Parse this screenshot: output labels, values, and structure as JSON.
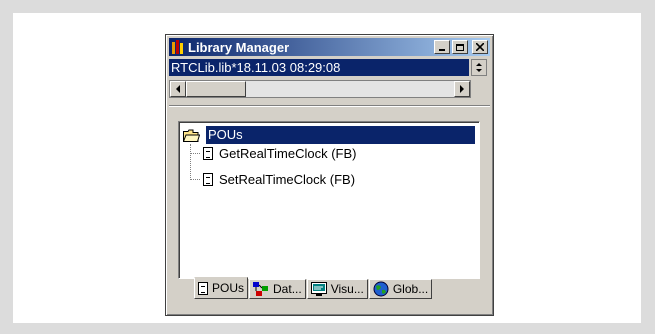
{
  "window": {
    "title": "Library Manager",
    "controls": {
      "minimize": "_",
      "maximize": "□",
      "close": "×"
    }
  },
  "library": {
    "entry": "RTCLib.lib*18.11.03 08:29:08"
  },
  "tree": {
    "root_label": "POUs",
    "items": [
      {
        "label": "GetRealTimeClock (FB)"
      },
      {
        "label": "SetRealTimeClock (FB)"
      }
    ]
  },
  "tabs": [
    {
      "label": "POUs",
      "icon": "document-icon",
      "active": true
    },
    {
      "label": "Dat...",
      "icon": "datatype-icon",
      "active": false
    },
    {
      "label": "Visu...",
      "icon": "visualization-icon",
      "active": false
    },
    {
      "label": "Glob...",
      "icon": "globe-icon",
      "active": false
    }
  ],
  "colors": {
    "titlebar_start": "#0a246a",
    "titlebar_end": "#a6caf0",
    "selection": "#0a246a",
    "chrome": "#d4d0c8"
  }
}
